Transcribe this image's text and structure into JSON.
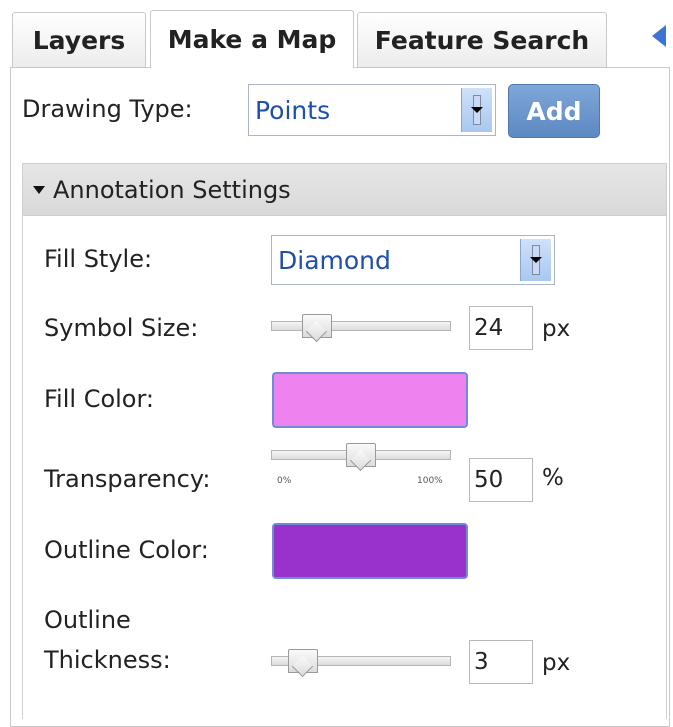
{
  "tabs": [
    {
      "label": "Layers"
    },
    {
      "label": "Make a Map"
    },
    {
      "label": "Feature Search"
    }
  ],
  "drawing": {
    "label": "Drawing Type:",
    "value": "Points",
    "add_label": "Add"
  },
  "annotation": {
    "header": "Annotation Settings",
    "fill_style_label": "Fill Style:",
    "fill_style_value": "Diamond",
    "symbol_size_label": "Symbol Size:",
    "symbol_size_value": "24",
    "symbol_size_unit": "px",
    "fill_color_label": "Fill Color:",
    "fill_color": "#ee82ee",
    "transparency_label": "Transparency:",
    "transparency_value": "50",
    "transparency_unit": "%",
    "transparency_min": "0%",
    "transparency_max": "100%",
    "outline_color_label": "Outline Color:",
    "outline_color": "#9932cc",
    "outline_thickness_label_1": "Outline",
    "outline_thickness_label_2": "Thickness:",
    "outline_thickness_value": "3",
    "outline_thickness_unit": "px"
  }
}
